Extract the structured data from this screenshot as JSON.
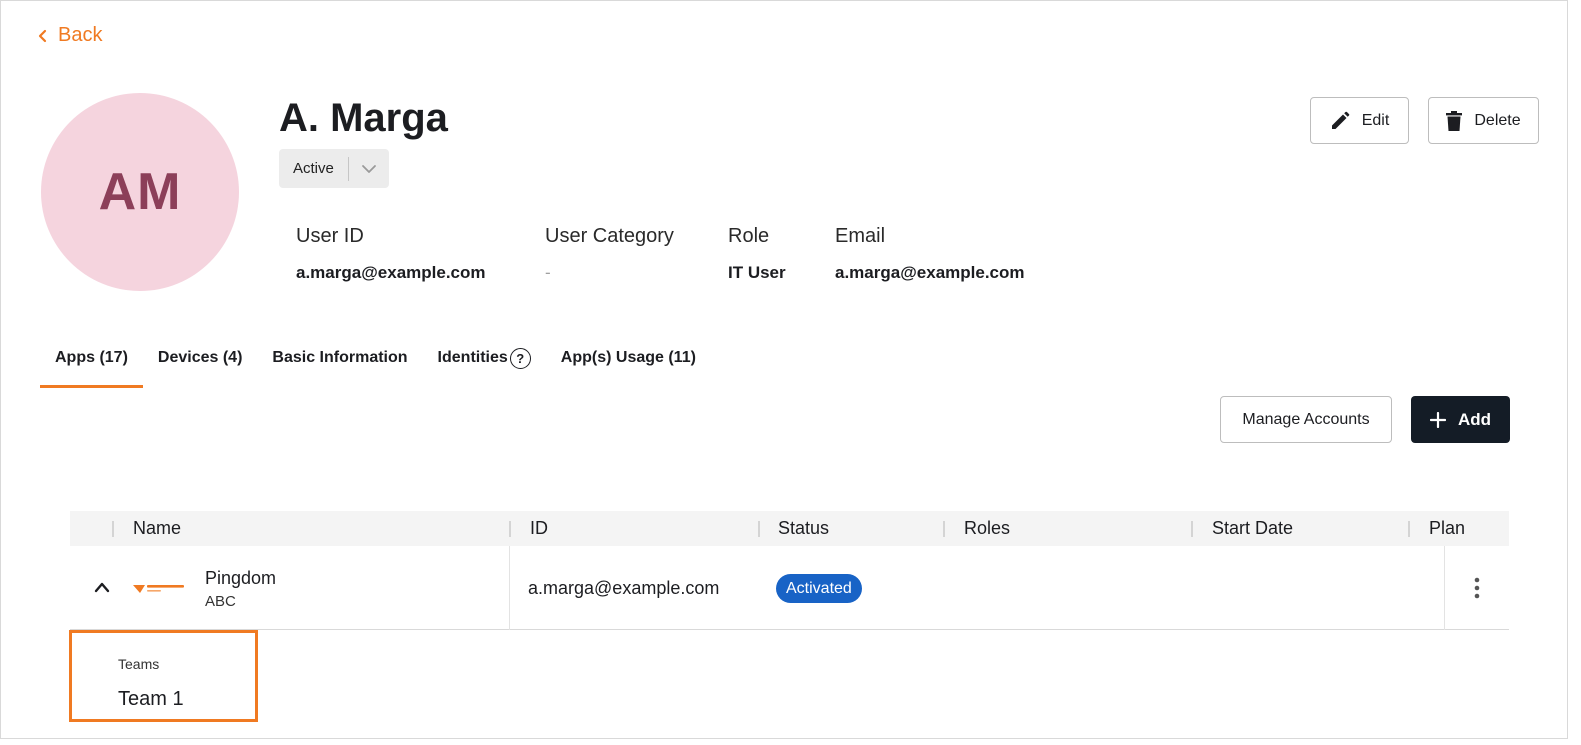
{
  "nav": {
    "back_label": "Back"
  },
  "user": {
    "initials": "AM",
    "name": "A. Marga",
    "status": "Active",
    "avatar_color": "#f5d4de",
    "avatar_text_color": "#8c3f59"
  },
  "actions": {
    "edit_label": "Edit",
    "delete_label": "Delete"
  },
  "info": {
    "user_id_label": "User ID",
    "user_id_value": "a.marga@example.com",
    "category_label": "User Category",
    "category_value": "-",
    "role_label": "Role",
    "role_value": "IT User",
    "email_label": "Email",
    "email_value": "a.marga@example.com"
  },
  "tabs": [
    {
      "label": "Apps (17)",
      "active": true
    },
    {
      "label": "Devices (4)",
      "active": false
    },
    {
      "label": "Basic Information",
      "active": false
    },
    {
      "label": "Identities",
      "active": false,
      "icon": "help-circle-icon"
    },
    {
      "label": "App(s) Usage (11)",
      "active": false
    }
  ],
  "toolbar": {
    "manage_label": "Manage Accounts",
    "add_label": "Add"
  },
  "table": {
    "columns": [
      "Name",
      "ID",
      "Status",
      "Roles",
      "Start Date",
      "Plan"
    ],
    "rows": [
      {
        "app": "Pingdom",
        "sub": "ABC",
        "logo": "solarwinds-logo",
        "id": "a.marga@example.com",
        "status": "Activated",
        "roles": "",
        "start_date": "",
        "plan": ""
      }
    ]
  },
  "expanded": {
    "teams_label": "Teams",
    "teams_value": "Team 1"
  },
  "colors": {
    "accent": "#f07a22",
    "primary_button": "#141c26",
    "status_badge": "#1863c6"
  }
}
